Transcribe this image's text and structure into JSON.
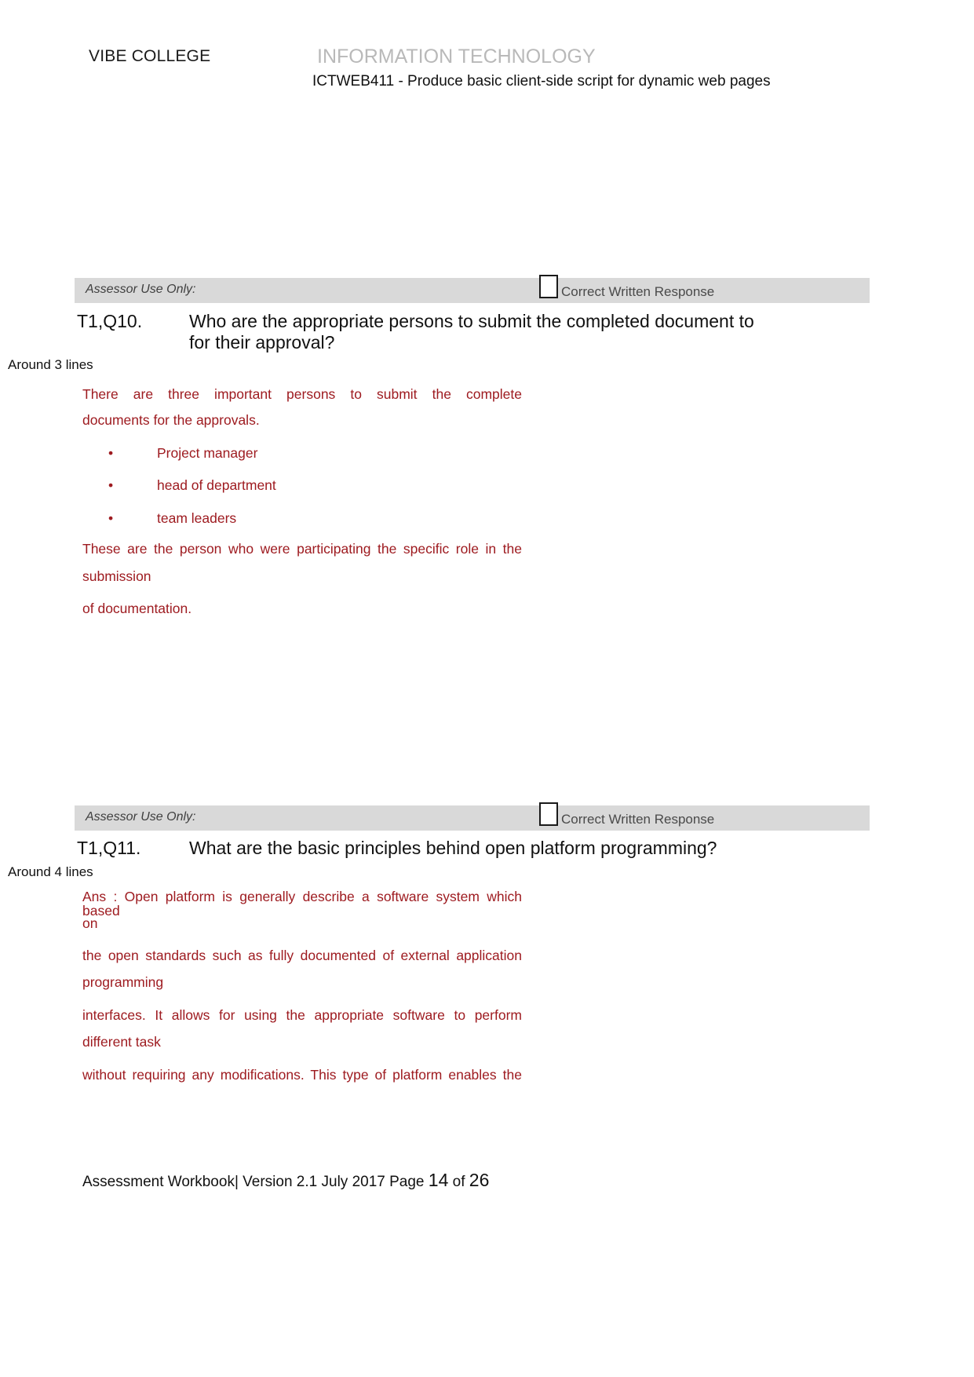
{
  "header": {
    "college": "VIBE COLLEGE",
    "department": "INFORMATION TECHNOLOGY",
    "unit": "ICTWEB411 - Produce basic client-side script for dynamic web pages"
  },
  "assessor_bar": {
    "label": "Assessor Use Only:",
    "checkbox_label": "Correct Written Response",
    "checkbox_checked": false
  },
  "questions": [
    {
      "id": "T1,Q10.",
      "text": "Who are the appropriate persons to submit the completed document to for their approval?",
      "hint": "Around 3 lines",
      "answer_lines": [
        "There are three important persons to submit the complete",
        "documents for the approvals."
      ],
      "bullets": [
        "Project manager",
        "head of department",
        "team leaders"
      ],
      "answer_lines2": [
        "These are the person who were participating the specific role in the",
        "submission",
        " of documentation."
      ]
    },
    {
      "id": "T1,Q11.",
      "text": "What are the basic principles behind open platform programming?",
      "hint": "Around 4 lines",
      "answer_lines": [
        "Ans : Open platform is generally describe a software system which based",
        "on",
        "the open standards such as fully documented of external application",
        "programming",
        "interfaces. It allows for using the appropriate software to perform",
        "different task",
        "without requiring any modifications. This type of platform enables the"
      ]
    }
  ],
  "footer": {
    "text": "Assessment Workbook| Version 2.1 July 2017 Page ",
    "page_number": "14",
    "of": " of ",
    "total_pages": "26"
  },
  "colors": {
    "answer_red": "#9e1b20",
    "bar_gray": "#d9d9d9",
    "dept_gray": "#b9b9b9"
  }
}
